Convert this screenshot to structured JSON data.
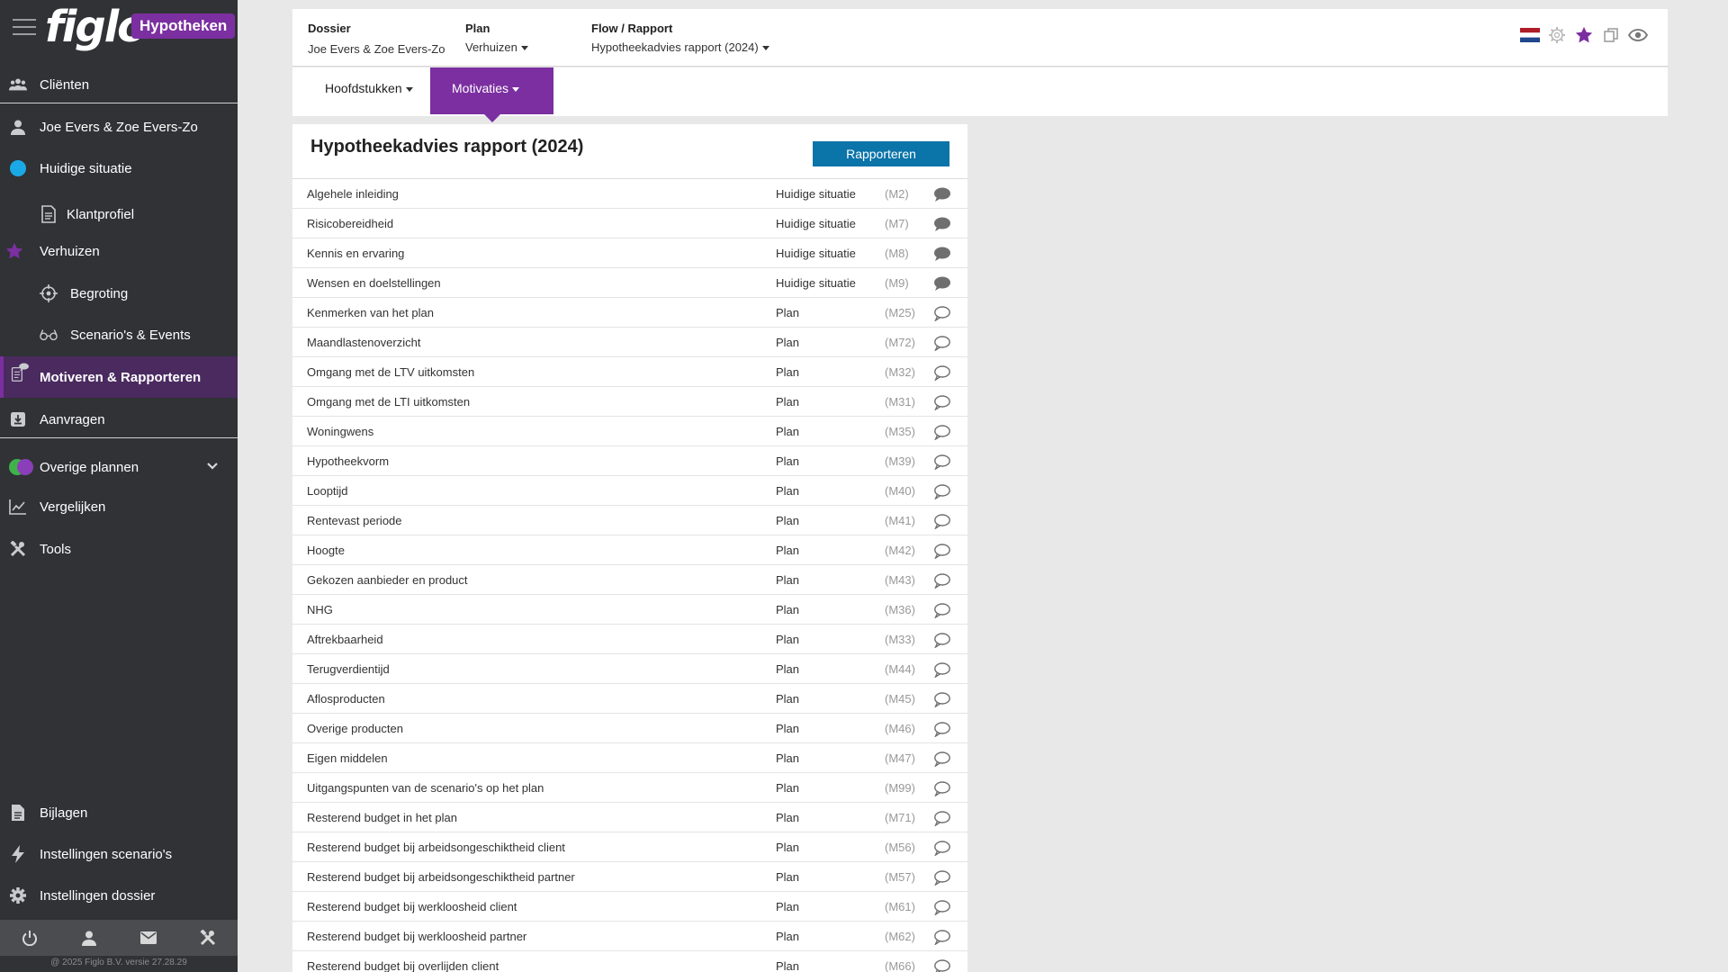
{
  "brand": {
    "logo": "figlo",
    "badge": "Hypotheken",
    "accent": "#7b2fa0",
    "primary_button": "#0b74a8"
  },
  "sidebar": {
    "items": [
      {
        "label": "Cliënten",
        "icon": "users-icon"
      },
      {
        "label": "Joe Evers & Zoe Evers-Zo",
        "icon": "user-icon"
      },
      {
        "label": "Huidige situatie",
        "icon": "blue-dot-icon"
      },
      {
        "label": "Klantprofiel",
        "icon": "document-icon"
      },
      {
        "label": "Verhuizen",
        "icon": "star-icon"
      },
      {
        "label": "Begroting",
        "icon": "crosshair-icon"
      },
      {
        "label": "Scenario's & Events",
        "icon": "glasses-icon"
      },
      {
        "label": "Motiveren & Rapporteren",
        "icon": "report-comment-icon"
      },
      {
        "label": "Aanvragen",
        "icon": "send-box-icon"
      },
      {
        "label": "Overige plannen",
        "icon": "plans-circles-icon"
      },
      {
        "label": "Vergelijken",
        "icon": "chart-line-icon"
      },
      {
        "label": "Tools",
        "icon": "tools-icon"
      },
      {
        "label": "Bijlagen",
        "icon": "attachment-file-icon"
      },
      {
        "label": "Instellingen scenario's",
        "icon": "lightning-icon"
      },
      {
        "label": "Instellingen dossier",
        "icon": "gear-icon"
      }
    ],
    "footer_icons": [
      "power-icon",
      "profile-icon",
      "mail-icon",
      "tools-icon"
    ],
    "copyright": "@ 2025 Figlo B.V. versie 27.28.29"
  },
  "header": {
    "dossier_label": "Dossier",
    "dossier_value": "Joe Evers & Zoe Evers-Zo",
    "plan_label": "Plan",
    "plan_value": "Verhuizen",
    "flow_label": "Flow / Rapport",
    "flow_value": "Hypotheekadvies rapport (2024)",
    "icons": [
      "netherlands-flag-icon",
      "settings-icon",
      "star-icon",
      "copy-icon",
      "eye-icon"
    ]
  },
  "tabs": [
    {
      "label": "Hoofdstukken"
    },
    {
      "label": "Motivaties"
    }
  ],
  "report": {
    "title": "Hypotheekadvies rapport (2024)",
    "button": "Rapporteren",
    "rows": [
      {
        "title": "Algehele inleiding",
        "section": "Huidige situatie",
        "code": "(M2)",
        "filled": true
      },
      {
        "title": "Risicobereidheid",
        "section": "Huidige situatie",
        "code": "(M7)",
        "filled": true
      },
      {
        "title": "Kennis en ervaring",
        "section": "Huidige situatie",
        "code": "(M8)",
        "filled": true
      },
      {
        "title": "Wensen en doelstellingen",
        "section": "Huidige situatie",
        "code": "(M9)",
        "filled": true
      },
      {
        "title": "Kenmerken van het plan",
        "section": "Plan",
        "code": "(M25)",
        "filled": false
      },
      {
        "title": "Maandlastenoverzicht",
        "section": "Plan",
        "code": "(M72)",
        "filled": false
      },
      {
        "title": "Omgang met de LTV uitkomsten",
        "section": "Plan",
        "code": "(M32)",
        "filled": false
      },
      {
        "title": "Omgang met de LTI uitkomsten",
        "section": "Plan",
        "code": "(M31)",
        "filled": false
      },
      {
        "title": "Woningwens",
        "section": "Plan",
        "code": "(M35)",
        "filled": false
      },
      {
        "title": "Hypotheekvorm",
        "section": "Plan",
        "code": "(M39)",
        "filled": false
      },
      {
        "title": "Looptijd",
        "section": "Plan",
        "code": "(M40)",
        "filled": false
      },
      {
        "title": "Rentevast periode",
        "section": "Plan",
        "code": "(M41)",
        "filled": false
      },
      {
        "title": "Hoogte",
        "section": "Plan",
        "code": "(M42)",
        "filled": false
      },
      {
        "title": "Gekozen aanbieder en product",
        "section": "Plan",
        "code": "(M43)",
        "filled": false
      },
      {
        "title": "NHG",
        "section": "Plan",
        "code": "(M36)",
        "filled": false
      },
      {
        "title": "Aftrekbaarheid",
        "section": "Plan",
        "code": "(M33)",
        "filled": false
      },
      {
        "title": "Terugverdientijd",
        "section": "Plan",
        "code": "(M44)",
        "filled": false
      },
      {
        "title": "Aflosproducten",
        "section": "Plan",
        "code": "(M45)",
        "filled": false
      },
      {
        "title": "Overige producten",
        "section": "Plan",
        "code": "(M46)",
        "filled": false
      },
      {
        "title": "Eigen middelen",
        "section": "Plan",
        "code": "(M47)",
        "filled": false
      },
      {
        "title": "Uitgangspunten van de scenario's op het plan",
        "section": "Plan",
        "code": "(M99)",
        "filled": false
      },
      {
        "title": "Resterend budget in het plan",
        "section": "Plan",
        "code": "(M71)",
        "filled": false
      },
      {
        "title": "Resterend budget bij arbeidsongeschiktheid client",
        "section": "Plan",
        "code": "(M56)",
        "filled": false
      },
      {
        "title": "Resterend budget bij arbeidsongeschiktheid partner",
        "section": "Plan",
        "code": "(M57)",
        "filled": false
      },
      {
        "title": "Resterend budget bij werkloosheid client",
        "section": "Plan",
        "code": "(M61)",
        "filled": false
      },
      {
        "title": "Resterend budget bij werkloosheid partner",
        "section": "Plan",
        "code": "(M62)",
        "filled": false
      },
      {
        "title": "Resterend budget bij overlijden client",
        "section": "Plan",
        "code": "(M66)",
        "filled": false
      }
    ]
  }
}
